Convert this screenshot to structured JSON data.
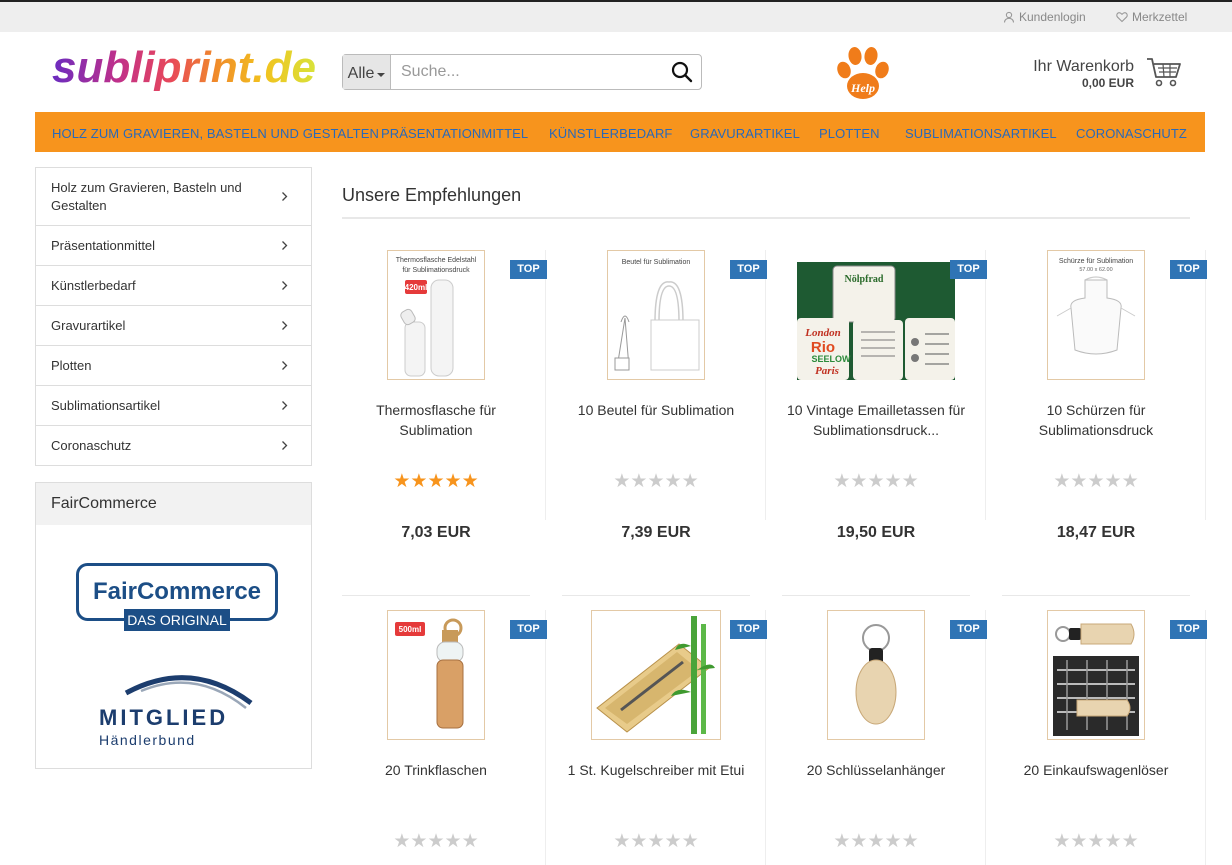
{
  "topbar": {
    "login_label": "Kundenlogin",
    "wishlist_label": "Merkzettel"
  },
  "header": {
    "logo_text": "subliprint.de",
    "search_category": "Alle",
    "search_placeholder": "Suche...",
    "help_label": "Help",
    "cart_label": "Ihr Warenkorb",
    "cart_value": "0,00 EUR"
  },
  "nav": {
    "items": [
      "HOLZ ZUM GRAVIEREN, BASTELN UND GESTALTEN",
      "PRÄSENTATIONMITTEL",
      "KÜNSTLERBEDARF",
      "GRAVURARTIKEL",
      "PLOTTEN",
      "SUBLIMATIONSARTIKEL",
      "CORONASCHUTZ"
    ]
  },
  "sidebar": {
    "items": [
      "Holz zum Gravieren, Basteln und Gestalten",
      "Präsentationmittel",
      "Künstlerbedarf",
      "Gravurartikel",
      "Plotten",
      "Sublimationsartikel",
      "Coronaschutz"
    ],
    "faircommerce": {
      "title": "FairCommerce",
      "logo_line1": "FairCommerce",
      "logo_line2": "DAS ORIGINAL",
      "member_line1": "MITGLIED",
      "member_line2": "Händlerbund"
    }
  },
  "main": {
    "title": "Unsere Empfehlungen",
    "products": [
      {
        "badge": "TOP",
        "name": "Thermosflasche für Sublimation",
        "rating": 5,
        "price": "7,03 EUR",
        "image": "thermos-bottle",
        "img_text1": "Thermosflasche Edelstahl",
        "img_text2": "für Sublimationsdruck",
        "img_tag": "420ml"
      },
      {
        "badge": "TOP",
        "name": "10 Beutel für Sublimation",
        "rating": 0,
        "price": "7,39 EUR",
        "image": "tote-bag",
        "img_text1": "Beutel für Sublimation"
      },
      {
        "badge": "TOP",
        "name": "10 Vintage Emailletassen für Sublimationsdruck...",
        "rating": 0,
        "price": "19,50 EUR",
        "image": "enamel-mugs",
        "img_text1": "Nölpfrad",
        "img_text2": "London",
        "img_text3": "Rio",
        "img_text4": "SEELOW",
        "img_text5": "Paris"
      },
      {
        "badge": "TOP",
        "name": "10 Schürzen für Sublimationsdruck",
        "rating": 0,
        "price": "18,47 EUR",
        "image": "apron",
        "img_text1": "Schürze für Sublimation",
        "img_text2": "57.00 x 62.00"
      },
      {
        "badge": "TOP",
        "name": "20 Trinkflaschen",
        "rating": 0,
        "price": "",
        "image": "glass-bottle",
        "img_tag": "500ml"
      },
      {
        "badge": "TOP",
        "name": "1 St. Kugelschreiber mit Etui",
        "rating": 0,
        "price": "",
        "image": "bamboo-pen"
      },
      {
        "badge": "TOP",
        "name": "20 Schlüsselanhänger",
        "rating": 0,
        "price": "",
        "image": "wood-keychain"
      },
      {
        "badge": "TOP",
        "name": "20 Einkaufswagenlöser",
        "rating": 0,
        "price": "",
        "image": "cart-chip"
      }
    ]
  },
  "colors": {
    "nav_bg": "#f7941d",
    "nav_text": "#2a69b8",
    "badge_bg": "#2f74b5",
    "star_filled": "#f7941d",
    "star_empty": "#cccccc"
  }
}
